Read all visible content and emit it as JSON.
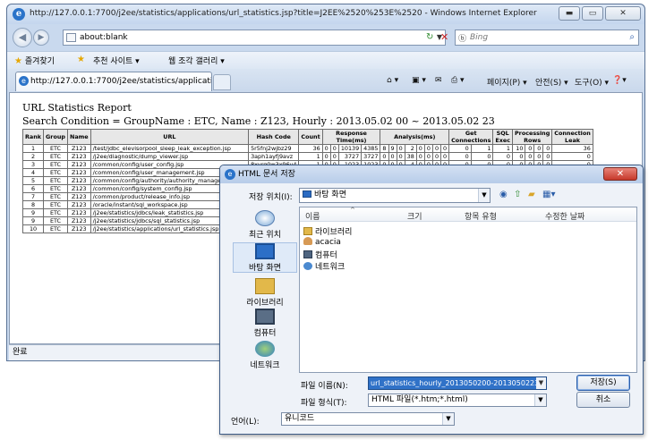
{
  "browser": {
    "title": "http://127.0.0.1:7700/j2ee/statistics/applications/url_statistics.jsp?title=J2EE%2520%253E%2520 - Windows Internet Explorer",
    "address": "about:blank",
    "search_placeholder": "Bing",
    "favorites_label": "즐겨찾기",
    "suggested_sites": "추천 사이트 ▾",
    "web_slice": "웹 조각 갤러리 ▾",
    "tab_title": "http://127.0.0.1:7700/j2ee/statistics/application...",
    "cmd_page": "페이지(P) ▾",
    "cmd_safety": "안전(S) ▾",
    "cmd_tools": "도구(O) ▾",
    "status": "완료"
  },
  "report": {
    "title": "URL Statistics Report",
    "condition": "Search Condition = GroupName : ETC, Name : Z123, Hourly : 2013.05.02 00 ~ 2013.05.02 23",
    "headers": {
      "rank": "Rank",
      "group": "Group",
      "name": "Name",
      "url": "URL",
      "hash": "Hash Code",
      "count": "Count",
      "response": "Response Time(ms)",
      "analysis": "Analysis(ms)",
      "get_conn": "Get Connections",
      "sql_exec": "SQL Exec",
      "proc_rows": "Processing Rows",
      "conn_leak": "Connection Leak"
    },
    "rows": [
      {
        "rank": "1",
        "group": "ETC",
        "name": "Z123",
        "url": "/test/jdbc_elevisorpool_sleep_leak_exception.jsp",
        "hash": "5r5fnj2wjbz29",
        "count": "36",
        "r1": "0",
        "r2": "0",
        "r3": "10139",
        "r4": "4385",
        "a": [
          "8",
          "9",
          "0",
          "2",
          "0",
          "0",
          "0",
          "0"
        ],
        "gc": [
          "0",
          "1"
        ],
        "sql": "1",
        "pr": [
          "10",
          "0",
          "0",
          "0"
        ],
        "leak": "36"
      },
      {
        "rank": "2",
        "group": "ETC",
        "name": "Z123",
        "url": "/j2ee/diagnostic/dump_viewer.jsp",
        "hash": "3aph1ayfj9avz",
        "count": "1",
        "r1": "0",
        "r2": "0",
        "r3": "3727",
        "r4": "3727",
        "a": [
          "0",
          "0",
          "0",
          "38",
          "0",
          "0",
          "0",
          "0"
        ],
        "gc": [
          "0",
          "0"
        ],
        "sql": "0",
        "pr": [
          "0",
          "0",
          "0",
          "0"
        ],
        "leak": "0"
      },
      {
        "rank": "3",
        "group": "ETC",
        "name": "Z123",
        "url": "/common/config/user_config.jsp",
        "hash": "8xvrg0w3x96v4",
        "count": "1",
        "r1": "0",
        "r2": "0",
        "r3": "1023",
        "r4": "1023",
        "a": [
          "0",
          "0",
          "0",
          "4",
          "0",
          "0",
          "0",
          "0"
        ],
        "gc": [
          "0",
          "0"
        ],
        "sql": "0",
        "pr": [
          "0",
          "0",
          "0",
          "0"
        ],
        "leak": "0"
      },
      {
        "rank": "4",
        "group": "ETC",
        "name": "Z123",
        "url": "/common/config/user_management.jsp",
        "hash": "",
        "count": "",
        "r1": "",
        "r2": "",
        "r3": "",
        "r4": "",
        "a": [
          "",
          "",
          "",
          "",
          "",
          "",
          "",
          ""
        ],
        "gc": [
          "",
          ""
        ],
        "sql": "",
        "pr": [
          "",
          "",
          "",
          ""
        ],
        "leak": ""
      },
      {
        "rank": "5",
        "group": "ETC",
        "name": "Z123",
        "url": "/common/config/authority/authority_management.jsp",
        "hash": "",
        "count": "",
        "r1": "",
        "r2": "",
        "r3": "",
        "r4": "",
        "a": [
          "",
          "",
          "",
          "",
          "",
          "",
          "",
          ""
        ],
        "gc": [
          "",
          ""
        ],
        "sql": "",
        "pr": [
          "",
          "",
          "",
          ""
        ],
        "leak": ""
      },
      {
        "rank": "6",
        "group": "ETC",
        "name": "Z123",
        "url": "/common/config/system_config.jsp",
        "hash": "",
        "count": "",
        "r1": "",
        "r2": "",
        "r3": "",
        "r4": "",
        "a": [
          "",
          "",
          "",
          "",
          "",
          "",
          "",
          ""
        ],
        "gc": [
          "",
          ""
        ],
        "sql": "",
        "pr": [
          "",
          "",
          "",
          ""
        ],
        "leak": ""
      },
      {
        "rank": "7",
        "group": "ETC",
        "name": "Z123",
        "url": "/common/product/release_info.jsp",
        "hash": "",
        "count": "",
        "r1": "",
        "r2": "",
        "r3": "",
        "r4": "",
        "a": [
          "",
          "",
          "",
          "",
          "",
          "",
          "",
          ""
        ],
        "gc": [
          "",
          ""
        ],
        "sql": "",
        "pr": [
          "",
          "",
          "",
          ""
        ],
        "leak": ""
      },
      {
        "rank": "8",
        "group": "ETC",
        "name": "Z123",
        "url": "/oracle/instant/sql_workspace.jsp",
        "hash": "",
        "count": "",
        "r1": "",
        "r2": "",
        "r3": "",
        "r4": "",
        "a": [
          "",
          "",
          "",
          "",
          "",
          "",
          "",
          ""
        ],
        "gc": [
          "",
          ""
        ],
        "sql": "",
        "pr": [
          "",
          "",
          "",
          ""
        ],
        "leak": ""
      },
      {
        "rank": "9",
        "group": "ETC",
        "name": "Z123",
        "url": "/j2ee/statistics/jdbcs/leak_statistics.jsp",
        "hash": "",
        "count": "",
        "r1": "",
        "r2": "",
        "r3": "",
        "r4": "",
        "a": [
          "",
          "",
          "",
          "",
          "",
          "",
          "",
          ""
        ],
        "gc": [
          "",
          ""
        ],
        "sql": "",
        "pr": [
          "",
          "",
          "",
          ""
        ],
        "leak": ""
      },
      {
        "rank": "9",
        "group": "ETC",
        "name": "Z123",
        "url": "/j2ee/statistics/jdbcs/sql_statistics.jsp",
        "hash": "",
        "count": "",
        "r1": "",
        "r2": "",
        "r3": "",
        "r4": "",
        "a": [
          "",
          "",
          "",
          "",
          "",
          "",
          "",
          ""
        ],
        "gc": [
          "",
          ""
        ],
        "sql": "",
        "pr": [
          "",
          "",
          "",
          ""
        ],
        "leak": ""
      },
      {
        "rank": "10",
        "group": "ETC",
        "name": "Z123",
        "url": "/j2ee/statistics/applications/url_statistics.jsp",
        "hash": "",
        "count": "",
        "r1": "",
        "r2": "",
        "r3": "",
        "r4": "",
        "a": [
          "",
          "",
          "",
          "",
          "",
          "",
          "",
          ""
        ],
        "gc": [
          "",
          ""
        ],
        "sql": "",
        "pr": [
          "",
          "",
          "",
          ""
        ],
        "leak": ""
      }
    ]
  },
  "dialog": {
    "title": "HTML 문서 저장",
    "save_in_label": "저장 위치(I):",
    "save_in_value": "바탕 화면",
    "places": [
      "최근 위치",
      "바탕 화면",
      "라이브러리",
      "컴퓨터",
      "네트워크"
    ],
    "columns": {
      "name": "이름",
      "size": "크기",
      "type": "항목 유형",
      "modified": "수정한 날짜"
    },
    "items": [
      "라이브러리",
      "acacia",
      "컴퓨터",
      "네트워크"
    ],
    "filename_label": "파일 이름(N):",
    "filename_value": "url_statistics_hourly_2013050200-2013050223.htm",
    "filetype_label": "파일 형식(T):",
    "filetype_value": "HTML 파일(*.htm;*.html)",
    "encoding_label": "언어(L):",
    "encoding_value": "유니코드",
    "save_button": "저장(S)",
    "cancel_button": "취소"
  }
}
